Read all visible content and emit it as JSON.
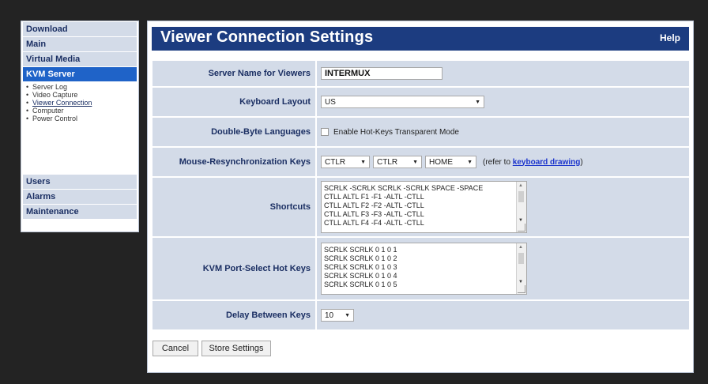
{
  "sidebar": {
    "download": "Download",
    "main": "Main",
    "virtual_media": "Virtual Media",
    "kvm_server": "KVM Server",
    "sub_items": [
      "Server Log",
      "Video Capture",
      "Viewer Connection",
      "Computer",
      "Power Control"
    ],
    "users": "Users",
    "alarms": "Alarms",
    "maintenance": "Maintenance"
  },
  "header": {
    "title": "Viewer Connection Settings",
    "help": "Help"
  },
  "form": {
    "server_name": {
      "label": "Server Name for Viewers",
      "value": "INTERMUX"
    },
    "keyboard_layout": {
      "label": "Keyboard Layout",
      "value": "US"
    },
    "double_byte": {
      "label": "Double-Byte Languages",
      "checkbox_label": "Enable Hot-Keys Transparent Mode",
      "checked": false
    },
    "mouse_resync": {
      "label": "Mouse-Resynchronization Keys",
      "key1": "CTLR",
      "key2": "CTLR",
      "key3": "HOME",
      "refer_prefix": "(refer to ",
      "refer_link": "keyboard drawing",
      "refer_suffix": ")"
    },
    "shortcuts": {
      "label": "Shortcuts",
      "lines": [
        "SCRLK -SCRLK SCRLK -SCRLK SPACE -SPACE",
        "CTLL ALTL F1 -F1 -ALTL -CTLL",
        "CTLL ALTL F2 -F2 -ALTL -CTLL",
        "CTLL ALTL F3 -F3 -ALTL -CTLL",
        "CTLL ALTL F4 -F4 -ALTL -CTLL"
      ]
    },
    "port_select": {
      "label": "KVM Port-Select Hot Keys",
      "lines": [
        "SCRLK SCRLK 0 1 0 1",
        "SCRLK SCRLK 0 1 0 2",
        "SCRLK SCRLK 0 1 0 3",
        "SCRLK SCRLK 0 1 0 4",
        "SCRLK SCRLK 0 1 0 5"
      ]
    },
    "delay": {
      "label": "Delay Between Keys",
      "value": "10"
    }
  },
  "buttons": {
    "cancel": "Cancel",
    "store": "Store Settings"
  },
  "colors": {
    "title_bg": "#1c3c80",
    "row_bg": "#d3dbe8",
    "active_nav": "#1f63c8",
    "link": "#1a33cc"
  }
}
